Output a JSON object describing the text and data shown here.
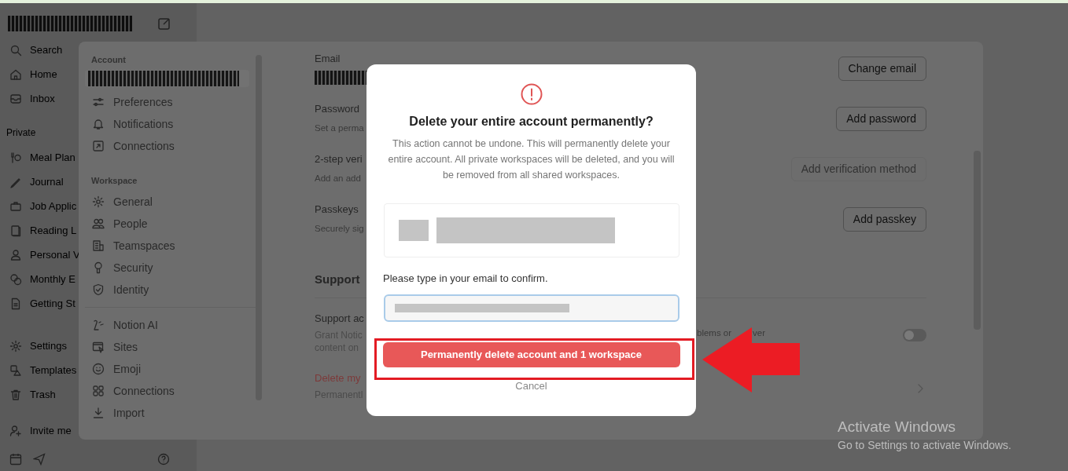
{
  "sidebar": {
    "top_items": [
      "Search",
      "Home",
      "Inbox"
    ],
    "private_heading": "Private",
    "private_items": [
      "Meal Plan",
      "Journal",
      "Job Applic",
      "Reading L",
      "Personal V",
      "Monthly E",
      "Getting St"
    ],
    "bottom_items": [
      "Settings",
      "Templates",
      "Trash"
    ],
    "invite": "Invite me"
  },
  "settings": {
    "nav": [
      {
        "heading": "Account",
        "profile": true,
        "items": [
          "Preferences",
          "Notifications",
          "Connections"
        ]
      },
      {
        "heading": "Workspace",
        "profile": false,
        "items": [
          "General",
          "People",
          "Teamspaces",
          "Security",
          "Identity"
        ]
      },
      {
        "profile": false,
        "items": [
          "Notion AI",
          "Sites",
          "Emoji",
          "Connections",
          "Import"
        ]
      }
    ],
    "rows": [
      {
        "label": "Email",
        "redacted": true,
        "button": "Change email",
        "disabled": false
      },
      {
        "label": "Password",
        "description": "Set a perma",
        "button": "Add password",
        "disabled": false
      },
      {
        "label": "2-step veri",
        "description": "Add an add",
        "button": "Add verification method",
        "disabled": true
      },
      {
        "label": "Passkeys",
        "description": "Securely sig",
        "button": "Add passkey",
        "disabled": false
      }
    ],
    "support_heading": "Support",
    "support_rows": [
      {
        "kind": "toggle",
        "label": "Support ac",
        "description": "Grant Notic",
        "description_2": "content on",
        "tail": "blems or",
        "tail_2": "ver",
        "on": false
      },
      {
        "kind": "link",
        "label": "Delete my",
        "description": "Permanentl"
      }
    ]
  },
  "dialog": {
    "title": "Delete your entire account permanently?",
    "message": "This action cannot be undone. This will permanently delete your entire account. All private workspaces will be deleted, and you will be removed from all shared workspaces.",
    "prompt": "Please type in your email to confirm.",
    "confirm_button": "Permanently delete account and 1 workspace",
    "cancel": "Cancel"
  },
  "os_notice": {
    "title": "Activate Windows",
    "message": "Go to Settings to activate Windows."
  }
}
